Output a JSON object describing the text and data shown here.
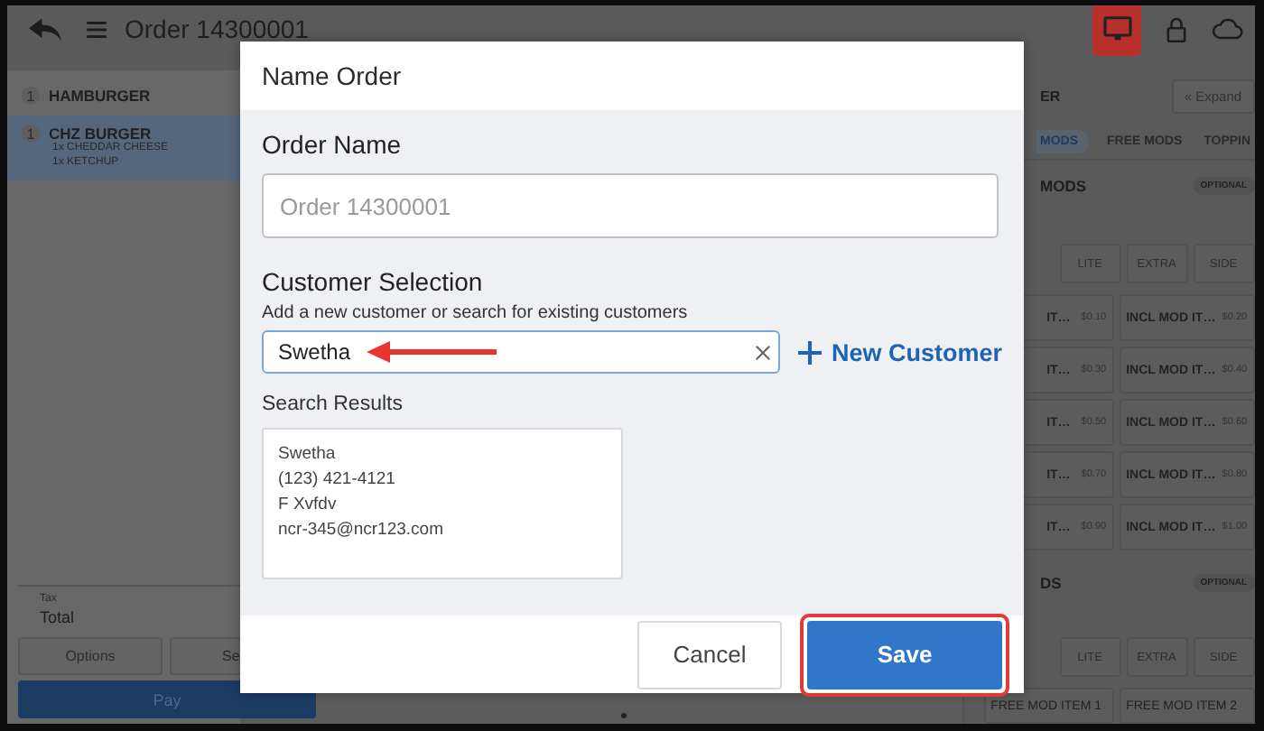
{
  "top_bar": {
    "title": "Order 14300001"
  },
  "order_items": [
    {
      "qty": "1",
      "name": "HAMBURGER",
      "selected": false
    },
    {
      "qty": "1",
      "name": "CHZ BURGER",
      "selected": true,
      "modifiers": [
        "1x CHEDDAR CHEESE",
        "1x KETCHUP"
      ]
    }
  ],
  "totals": {
    "tax_label": "Tax",
    "total_label": "Total"
  },
  "order_buttons": [
    "Options",
    "Se"
  ],
  "pay_button": "Pay",
  "mods_panel": {
    "title": "ER",
    "expand_button": "« Expand",
    "tabs": [
      {
        "label": "MODS",
        "selected": true
      },
      {
        "label": "FREE MODS",
        "selected": false
      },
      {
        "label": "TOPPIN",
        "selected": false
      }
    ],
    "sections": [
      {
        "title": "MODS",
        "badge": "OPTIONAL",
        "portions": [
          "LITE",
          "EXTRA",
          "SIDE"
        ],
        "items": [
          {
            "kind": "partial",
            "name": "IT…",
            "price": "$0.10"
          },
          {
            "kind": "full",
            "name": "INCL MOD IT…",
            "price": "$0.20"
          },
          {
            "kind": "partial",
            "name": "IT…",
            "price": "$0.30"
          },
          {
            "kind": "full",
            "name": "INCL MOD IT…",
            "price": "$0.40"
          },
          {
            "kind": "partial",
            "name": "IT…",
            "price": "$0.50"
          },
          {
            "kind": "full",
            "name": "INCL MOD IT…",
            "price": "$0.60"
          },
          {
            "kind": "partial",
            "name": "IT…",
            "price": "$0.70"
          },
          {
            "kind": "full",
            "name": "INCL MOD IT…",
            "price": "$0.80"
          },
          {
            "kind": "partial",
            "name": "IT…",
            "price": "$0.90"
          },
          {
            "kind": "full",
            "name": "INCL MOD IT…",
            "price": "$1.00"
          }
        ]
      },
      {
        "title": "DS",
        "badge": "OPTIONAL",
        "portions": [
          "LITE",
          "EXTRA",
          "SIDE"
        ],
        "items": [
          {
            "kind": "full",
            "name": "FREE MOD ITEM 1"
          },
          {
            "kind": "full",
            "name": "FREE MOD ITEM 2"
          }
        ]
      }
    ]
  },
  "dialog": {
    "title": "Name Order",
    "order_name": {
      "label": "Order Name",
      "placeholder": "Order 14300001"
    },
    "customer": {
      "label": "Customer Selection",
      "hint": "Add a new customer or search for existing customers",
      "value": "Swetha",
      "new_customer": "New Customer"
    },
    "results": {
      "label": "Search Results",
      "lines": [
        "Swetha",
        "(123) 421-4121",
        "F Xvfdv",
        "ncr-345@ncr123.com"
      ]
    },
    "buttons": [
      {
        "kind": "secondary",
        "label": "Cancel",
        "highlighted": false
      },
      {
        "kind": "primary",
        "label": "Save",
        "highlighted": true
      }
    ]
  }
}
